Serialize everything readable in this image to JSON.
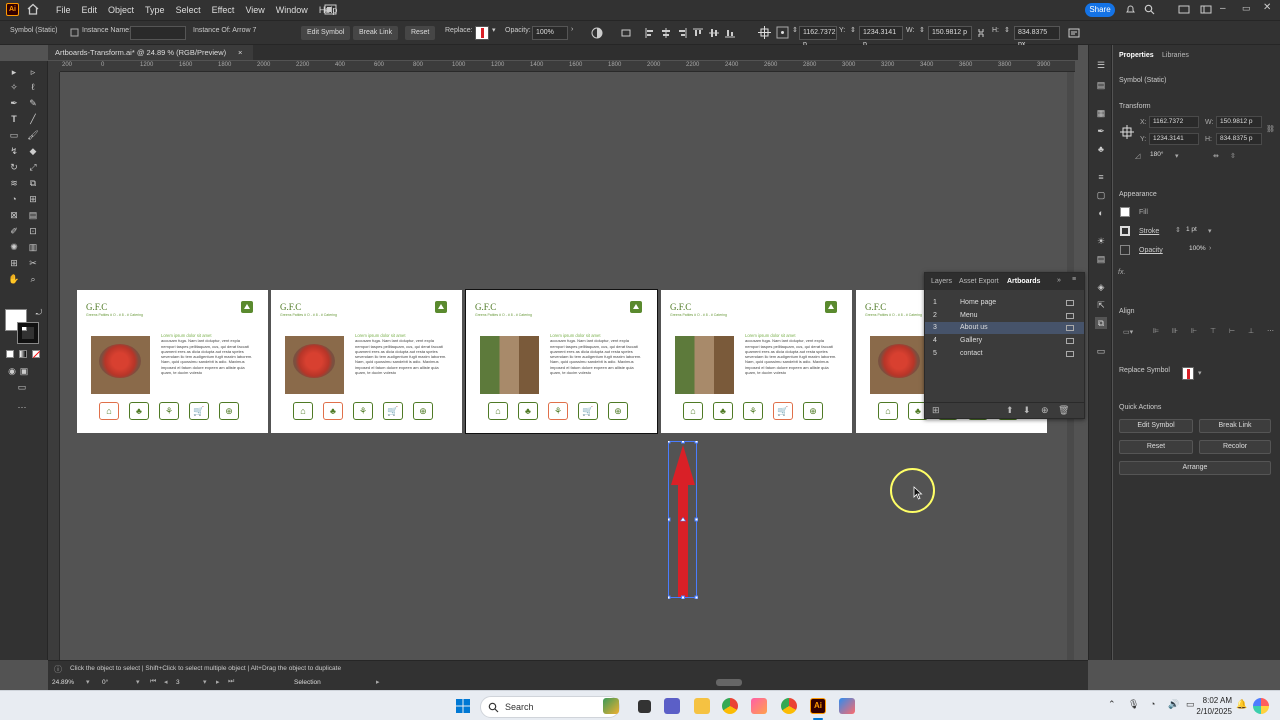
{
  "app": {
    "logo": "Ai",
    "menus": [
      "File",
      "Edit",
      "Object",
      "Type",
      "Select",
      "Effect",
      "View",
      "Window",
      "Help"
    ],
    "share_label": "Share"
  },
  "control_bar": {
    "selection_type": "Symbol (Static)",
    "instance_name_label": "Instance Name:",
    "instance_of": "Instance Of: Arrow 7",
    "edit_symbol": "Edit Symbol",
    "break_link": "Break Link",
    "reset": "Reset",
    "replace_label": "Replace:",
    "opacity_label": "Opacity:",
    "opacity_value": "100%",
    "x_label": "X:",
    "x_value": "1162.7372 p",
    "y_label": "Y:",
    "y_value": "1234.3141 p",
    "w_label": "W:",
    "w_value": "150.9812 p",
    "h_label": "H:",
    "h_value": "834.8375 px"
  },
  "document_tab": {
    "title": "Artboards-Transform.ai* @ 24.89 % (RGB/Preview)",
    "close": "×"
  },
  "ruler": {
    "labels": [
      "200",
      "0",
      "1200",
      "1600",
      "1800",
      "2000",
      "2200",
      "400",
      "600",
      "800",
      "1000",
      "1200",
      "1400",
      "1600",
      "1800",
      "2000",
      "2200",
      "2400",
      "2600",
      "2800",
      "3000",
      "3200",
      "3400",
      "3600",
      "3800",
      "3900"
    ]
  },
  "artboards": [
    {
      "title": "G.F.C",
      "subtitle": "Greens Patties  # O - # 8 - # Catering",
      "nav_icon": "home-icon",
      "image": "strawberry-cake",
      "selected_icon": 0
    },
    {
      "title": "G.F.C",
      "subtitle": "Greens Patties  # O - # 8 - # Catering",
      "nav_icon": "carrot-icon",
      "image": "strawberry-cake",
      "selected_icon": 1
    },
    {
      "title": "G.F.C",
      "subtitle": "Greens Patties  # O - # 8 - # Catering",
      "nav_icon": "people-icon",
      "image": "food-mosaic",
      "selected_icon": 2
    },
    {
      "title": "G.F.C",
      "subtitle": "Greens Patties  # O - # 8 - # Catering",
      "nav_icon": "cart-icon",
      "image": "food-mosaic",
      "selected_icon": 3
    },
    {
      "title": "G.F.C",
      "subtitle": "Greens Patties  # O - # 8 - # Catering",
      "nav_icon": "search-icon",
      "image": "strawberry-cake",
      "selected_icon": -1
    }
  ],
  "artboard_text": {
    "heading": "Lorem ipsum dolor sit amet",
    "body": "accusam fuga. Nam lant doluptur, vent expla nempori taspes pellitaquam, cus, qui derat faccati quament eres as dicia dolupta aut resta speles sevendam lic tem audigentum fugit maxim laborem. Nam, quid quossimu sandebit is adio. Maximus imposed el fatum dolore expeen am alliste quia quam, te ducim volesto"
  },
  "artboards_panel": {
    "tabs": [
      "Layers",
      "Asset Export",
      "Artboards"
    ],
    "active_tab": "Artboards",
    "rows": [
      {
        "num": "1",
        "name": "Home page"
      },
      {
        "num": "2",
        "name": "Menu"
      },
      {
        "num": "3",
        "name": "About us"
      },
      {
        "num": "4",
        "name": "Gallery"
      },
      {
        "num": "5",
        "name": "contact"
      }
    ],
    "selected_row": 2
  },
  "properties": {
    "tabs": [
      "Properties",
      "Libraries"
    ],
    "selection": "Symbol (Static)",
    "transform_label": "Transform",
    "x_label": "X:",
    "x": "1162.7372",
    "y_label": "Y:",
    "y": "1234.3141",
    "w_label": "W:",
    "w": "150.9812 p",
    "h_label": "H:",
    "h": "834.8375 p",
    "angle": "180°",
    "appearance_label": "Appearance",
    "fill_label": "Fill",
    "stroke_label": "Stroke",
    "stroke_value": "1 pt",
    "opacity_label": "Opacity",
    "opacity_value": "100%",
    "fx": "fx.",
    "align_label": "Align",
    "replace_symbol_label": "Replace Symbol",
    "quick_actions_label": "Quick Actions",
    "edit_symbol": "Edit Symbol",
    "break_link": "Break Link",
    "reset": "Reset",
    "recolor": "Recolor",
    "arrange": "Arrange"
  },
  "status": {
    "hint": "Click the object to select  |  Shift+Click to select multiple object  |  Alt+Drag the object to duplicate",
    "zoom": "24.89%",
    "rotation": "0°",
    "artboard_num": "3",
    "tool": "Selection"
  },
  "taskbar": {
    "search": "Search",
    "time": "8:02 AM",
    "date": "2/10/2025"
  },
  "colors": {
    "accent": "#1473e6",
    "arrow": "#d92027",
    "green": "#4f7a25"
  }
}
